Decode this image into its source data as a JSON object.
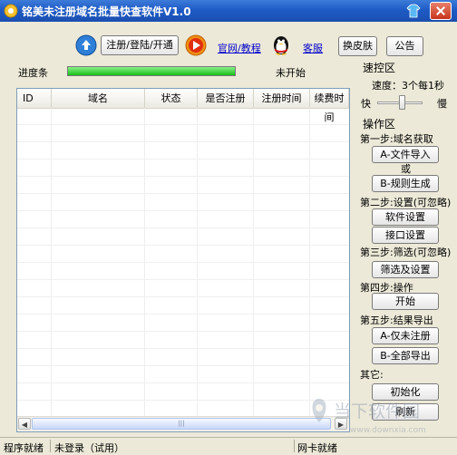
{
  "window": {
    "title": "铭美未注册域名批量快查软件V1.0"
  },
  "toolbar": {
    "register_label": "注册/登陆/开通",
    "website_link": "官网/教程",
    "support_link": "客服",
    "skin_label": "换皮肤",
    "notice_label": "公告"
  },
  "progress": {
    "label": "进度条",
    "value": 1.0,
    "status": "未开始"
  },
  "table": {
    "columns": [
      "ID",
      "域名",
      "状态",
      "是否注册",
      "注册时间",
      "续费时间"
    ],
    "rows": []
  },
  "speed": {
    "title": "速控区",
    "speed_text": "速度：3个每1秒",
    "fast_label": "快",
    "slow_label": "慢",
    "level": 0.55
  },
  "ops": {
    "title": "操作区",
    "step1": "第一步:域名获取",
    "file_import": "A-文件导入",
    "or": "或",
    "rule_gen": "B-规则生成",
    "step2": "第二步:设置(可忽略)",
    "software_settings": "软件设置",
    "interface_settings": "接口设置",
    "step3": "第三步:筛选(可忽略)",
    "filter_settings": "筛选及设置",
    "step4": "第四步:操作",
    "start": "开始",
    "step5": "第五步:结果导出",
    "export_unregistered": "A-仅未注册",
    "export_all": "B-全部导出",
    "other": "其它:",
    "init": "初始化",
    "refresh": "刷新"
  },
  "status": {
    "program": "程序就绪",
    "login": "未登录（试用）",
    "network": "网卡就绪"
  },
  "watermark": {
    "brand": "当下软件园",
    "url": "www.downxia.com"
  },
  "colors": {
    "titlebar": "#1E5BC6",
    "progress": "#16C016",
    "window_bg": "#ECE9D8"
  }
}
